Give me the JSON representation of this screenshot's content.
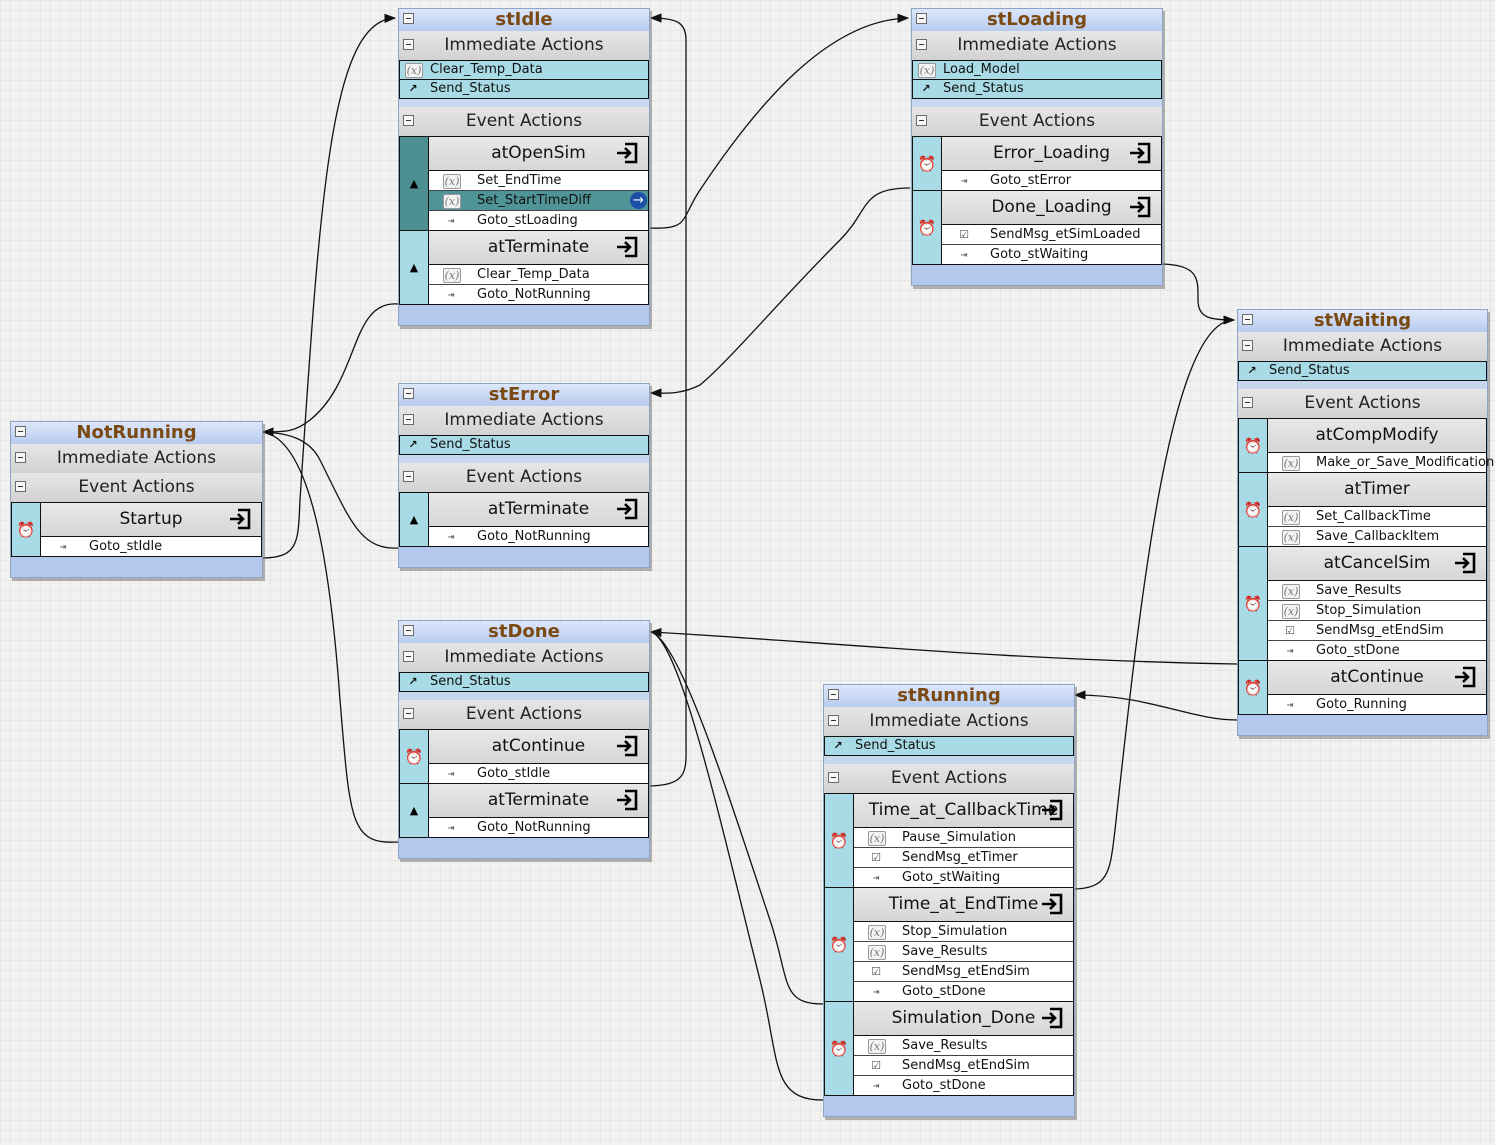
{
  "labels": {
    "immediate": "Immediate Actions",
    "event": "Event Actions"
  },
  "states": {
    "stIdle": {
      "title": "stIdle",
      "immediate": [
        {
          "label": "Clear_Temp_Data",
          "icon": "variable-icon"
        },
        {
          "label": "Send_Status",
          "icon": "send-status-icon"
        }
      ],
      "events": [
        {
          "name": "atOpenSim",
          "trigger": "up-triangle-icon",
          "selected": true,
          "actions": [
            {
              "label": "Set_EndTime",
              "icon": "variable-icon"
            },
            {
              "label": "Set_StartTimeDiff",
              "icon": "variable-icon",
              "highlight": true
            },
            {
              "label": "Goto_stLoading",
              "icon": "goto-icon"
            }
          ]
        },
        {
          "name": "atTerminate",
          "trigger": "up-triangle-icon",
          "actions": [
            {
              "label": "Clear_Temp_Data",
              "icon": "variable-icon"
            },
            {
              "label": "Goto_NotRunning",
              "icon": "goto-icon"
            }
          ]
        }
      ]
    },
    "stLoading": {
      "title": "stLoading",
      "immediate": [
        {
          "label": "Load_Model",
          "icon": "variable-icon"
        },
        {
          "label": "Send_Status",
          "icon": "send-status-icon"
        }
      ],
      "events": [
        {
          "name": "Error_Loading",
          "trigger": "alarm-clock-icon",
          "actions": [
            {
              "label": "Goto_stError",
              "icon": "goto-icon"
            }
          ]
        },
        {
          "name": "Done_Loading",
          "trigger": "alarm-clock-icon",
          "actions": [
            {
              "label": "SendMsg_etSimLoaded",
              "icon": "checkbox-icon"
            },
            {
              "label": "Goto_stWaiting",
              "icon": "goto-icon"
            }
          ]
        }
      ]
    },
    "stError": {
      "title": "stError",
      "immediate": [
        {
          "label": "Send_Status",
          "icon": "send-status-icon"
        }
      ],
      "events": [
        {
          "name": "atTerminate",
          "trigger": "up-triangle-icon",
          "actions": [
            {
              "label": "Goto_NotRunning",
              "icon": "goto-icon"
            }
          ]
        }
      ]
    },
    "NotRunning": {
      "title": "NotRunning",
      "immediate": [],
      "events": [
        {
          "name": "Startup",
          "trigger": "alarm-clock-icon",
          "actions": [
            {
              "label": "Goto_stIdle",
              "icon": "goto-icon"
            }
          ]
        }
      ]
    },
    "stDone": {
      "title": "stDone",
      "immediate": [
        {
          "label": "Send_Status",
          "icon": "send-status-icon"
        }
      ],
      "events": [
        {
          "name": "atContinue",
          "trigger": "alarm-clock-icon",
          "actions": [
            {
              "label": "Goto_stIdle",
              "icon": "goto-icon"
            }
          ]
        },
        {
          "name": "atTerminate",
          "trigger": "up-triangle-icon",
          "actions": [
            {
              "label": "Goto_NotRunning",
              "icon": "goto-icon"
            }
          ]
        }
      ]
    },
    "stWaiting": {
      "title": "stWaiting",
      "immediate": [
        {
          "label": "Send_Status",
          "icon": "send-status-icon"
        }
      ],
      "events": [
        {
          "name": "atCompModify",
          "trigger": "alarm-clock-icon",
          "noExit": true,
          "actions": [
            {
              "label": "Make_or_Save_Modification",
              "icon": "variable-icon"
            }
          ]
        },
        {
          "name": "atTimer",
          "trigger": "alarm-clock-icon",
          "noExit": true,
          "actions": [
            {
              "label": "Set_CallbackTime",
              "icon": "variable-icon"
            },
            {
              "label": "Save_CallbackItem",
              "icon": "variable-icon"
            }
          ]
        },
        {
          "name": "atCancelSim",
          "trigger": "alarm-clock-icon",
          "actions": [
            {
              "label": "Save_Results",
              "icon": "variable-icon"
            },
            {
              "label": "Stop_Simulation",
              "icon": "variable-icon"
            },
            {
              "label": "SendMsg_etEndSim",
              "icon": "checkbox-icon"
            },
            {
              "label": "Goto_stDone",
              "icon": "goto-icon"
            }
          ]
        },
        {
          "name": "atContinue",
          "trigger": "alarm-clock-icon",
          "actions": [
            {
              "label": "Goto_Running",
              "icon": "goto-icon"
            }
          ]
        }
      ]
    },
    "stRunning": {
      "title": "stRunning",
      "immediate": [
        {
          "label": "Send_Status",
          "icon": "send-status-icon"
        }
      ],
      "events": [
        {
          "name": "Time_at_CallbackTime",
          "trigger": "alarm-clock-icon",
          "actions": [
            {
              "label": "Pause_Simulation",
              "icon": "variable-icon"
            },
            {
              "label": "SendMsg_etTimer",
              "icon": "checkbox-icon"
            },
            {
              "label": "Goto_stWaiting",
              "icon": "goto-icon"
            }
          ]
        },
        {
          "name": "Time_at_EndTime",
          "trigger": "alarm-clock-icon",
          "actions": [
            {
              "label": "Stop_Simulation",
              "icon": "variable-icon"
            },
            {
              "label": "Save_Results",
              "icon": "variable-icon"
            },
            {
              "label": "SendMsg_etEndSim",
              "icon": "checkbox-icon"
            },
            {
              "label": "Goto_stDone",
              "icon": "goto-icon"
            }
          ]
        },
        {
          "name": "Simulation_Done",
          "trigger": "alarm-clock-icon",
          "actions": [
            {
              "label": "Save_Results",
              "icon": "variable-icon"
            },
            {
              "label": "SendMsg_etEndSim",
              "icon": "checkbox-icon"
            },
            {
              "label": "Goto_stDone",
              "icon": "goto-icon"
            }
          ]
        }
      ]
    }
  },
  "colors": {
    "title_text": "#7a4a12",
    "action_row": "#a9dbe6",
    "selected_event": "#4e8f91",
    "title_gradient_bottom": "#b7cbef",
    "wire": "#111111"
  }
}
